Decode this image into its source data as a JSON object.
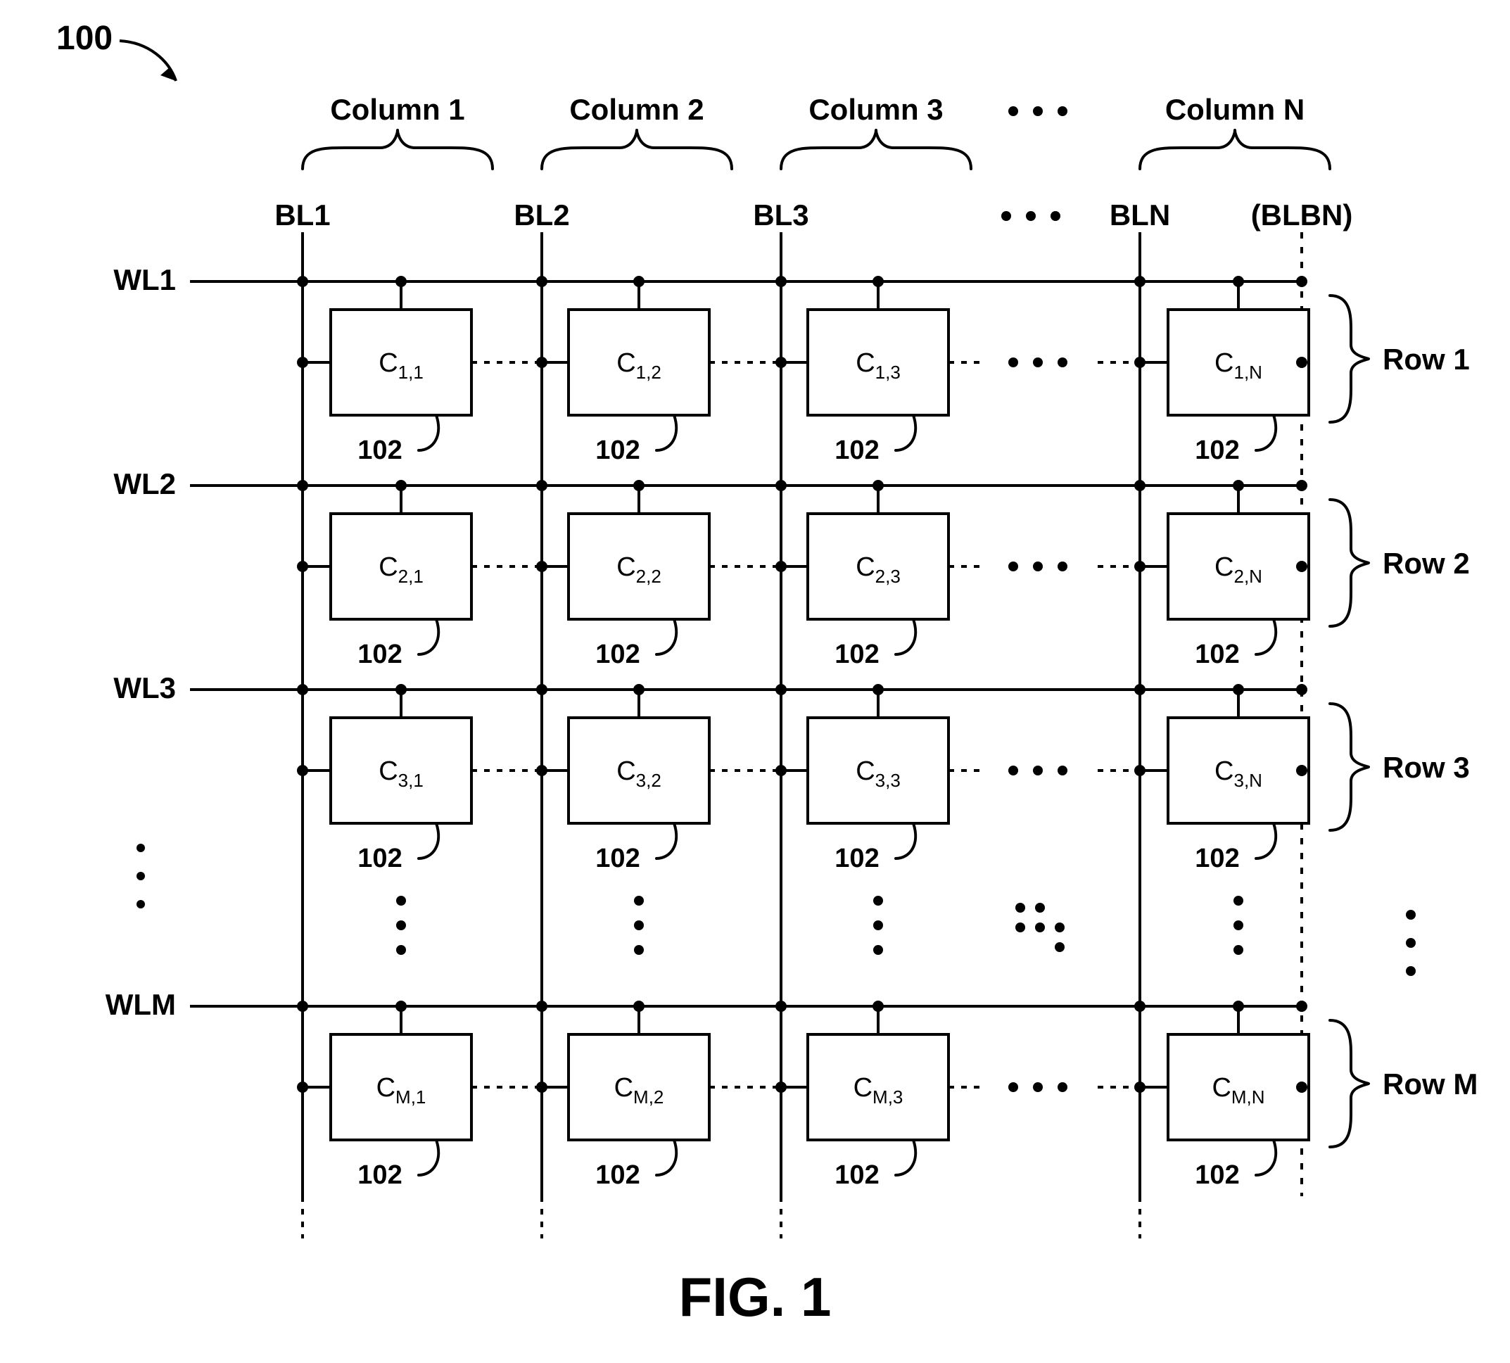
{
  "figure_ref": "100",
  "figure_title": "FIG. 1",
  "columns": [
    "Column 1",
    "Column 2",
    "Column 3",
    "Column N"
  ],
  "col_ellipsis": "• • •",
  "bitlines": [
    "BL1",
    "BL2",
    "BL3",
    "BLN",
    "(BLBN)"
  ],
  "bl_ellipsis": "• • •",
  "wordlines": [
    "WL1",
    "WL2",
    "WL3",
    "WLM"
  ],
  "wl_ellipsis": "⋮",
  "rows": [
    "Row 1",
    "Row 2",
    "Row 3",
    "Row M"
  ],
  "row_ellipsis": "⋮",
  "row_ellipsis_right": "⋮",
  "cell_ref": "102",
  "cells": {
    "r1": {
      "c1": {
        "main": "C",
        "sub": "1,1"
      },
      "c2": {
        "main": "C",
        "sub": "1,2"
      },
      "c3": {
        "main": "C",
        "sub": "1,3"
      },
      "cN": {
        "main": "C",
        "sub": "1,N"
      }
    },
    "r2": {
      "c1": {
        "main": "C",
        "sub": "2,1"
      },
      "c2": {
        "main": "C",
        "sub": "2,2"
      },
      "c3": {
        "main": "C",
        "sub": "2,3"
      },
      "cN": {
        "main": "C",
        "sub": "2,N"
      }
    },
    "r3": {
      "c1": {
        "main": "C",
        "sub": "3,1"
      },
      "c2": {
        "main": "C",
        "sub": "3,2"
      },
      "c3": {
        "main": "C",
        "sub": "3,3"
      },
      "cN": {
        "main": "C",
        "sub": "3,N"
      }
    },
    "rM": {
      "c1": {
        "main": "C",
        "sub": "M,1"
      },
      "c2": {
        "main": "C",
        "sub": "M,2"
      },
      "c3": {
        "main": "C",
        "sub": "M,3"
      },
      "cN": {
        "main": "C",
        "sub": "M,N"
      }
    }
  },
  "inter_dots": "• • •",
  "diag_dots": "⋱"
}
